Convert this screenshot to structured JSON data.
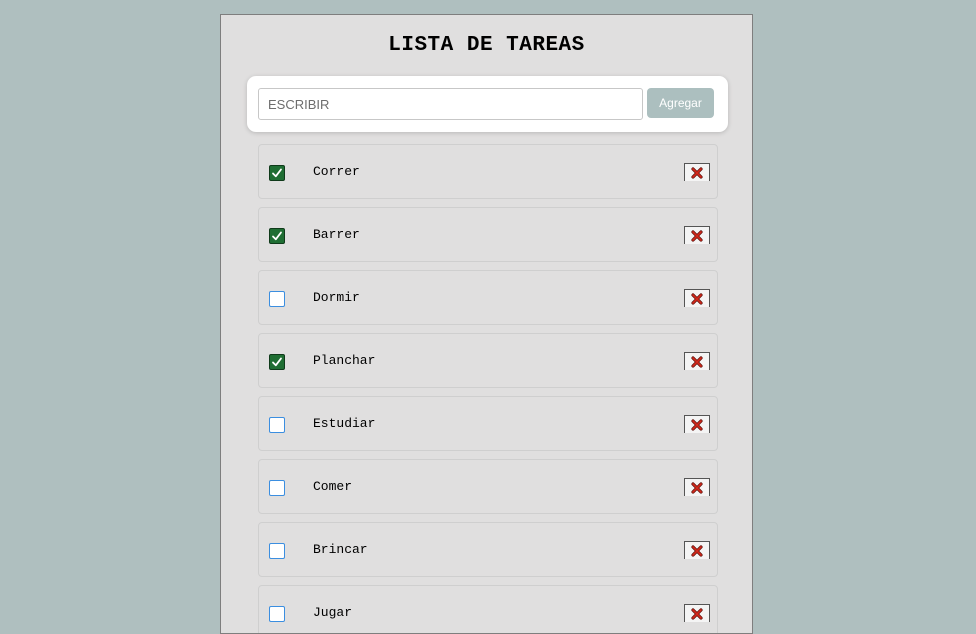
{
  "app": {
    "title": "LISTA DE TAREAS"
  },
  "form": {
    "placeholder": "ESCRIBIR",
    "value": "",
    "add_label": "Agregar"
  },
  "tasks": [
    {
      "label": "Correr",
      "done": true
    },
    {
      "label": "Barrer",
      "done": true
    },
    {
      "label": "Dormir",
      "done": false
    },
    {
      "label": "Planchar",
      "done": true
    },
    {
      "label": "Estudiar",
      "done": false
    },
    {
      "label": "Comer",
      "done": false
    },
    {
      "label": "Brincar",
      "done": false
    },
    {
      "label": "Jugar",
      "done": false
    }
  ],
  "icons": {
    "check": "check-icon",
    "delete": "close-x-icon"
  },
  "colors": {
    "background": "#afbfbf",
    "panel": "#e0dfdf",
    "button": "#acbfbf",
    "checked": "#1f6e33",
    "unchecked_border": "#3b8ee0",
    "delete_x": "#c0241a"
  }
}
